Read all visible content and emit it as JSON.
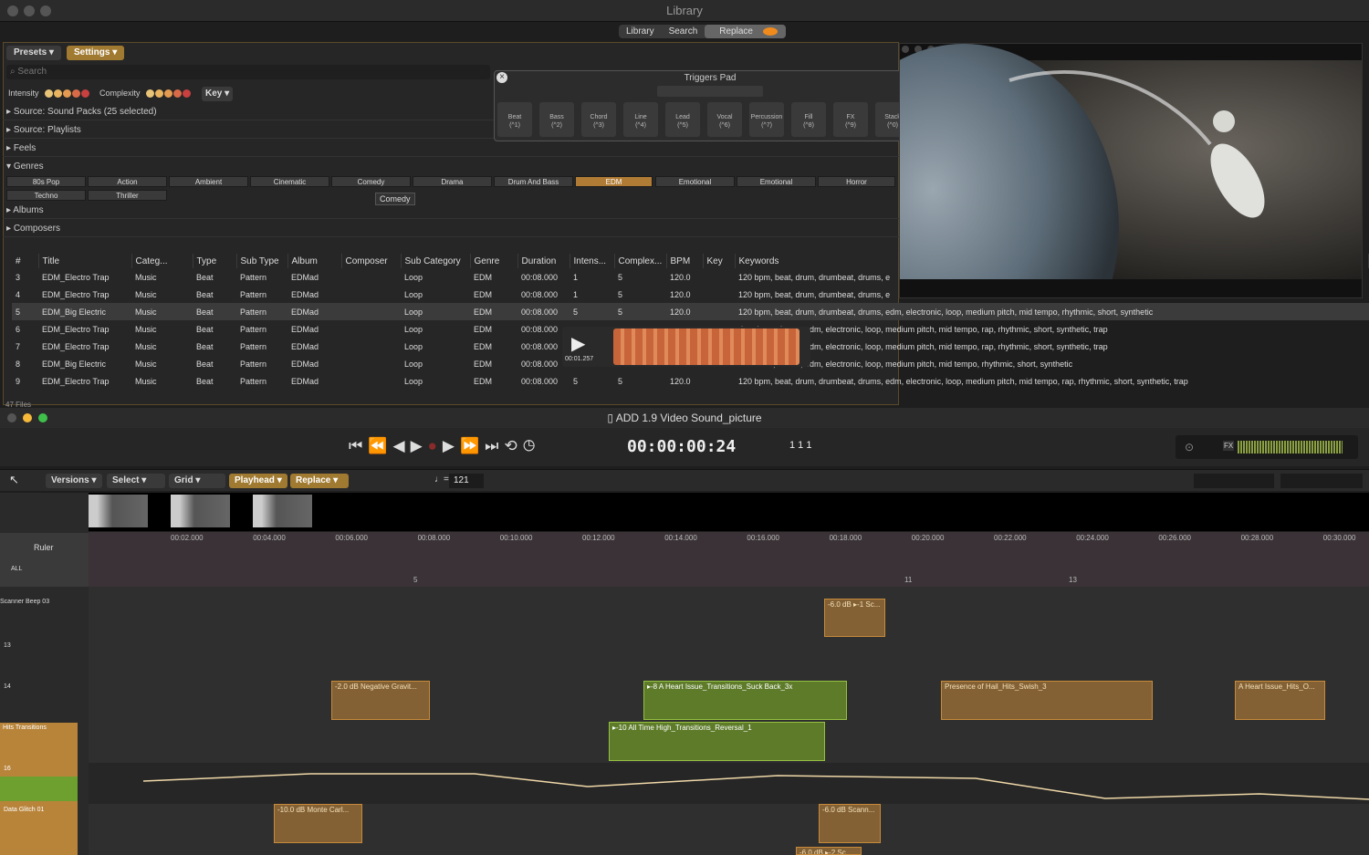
{
  "library": {
    "title": "Library",
    "tabs": [
      "Library",
      "Search",
      "Replace"
    ],
    "presets": "Presets",
    "settings": "Settings",
    "search_placeholder": "Search",
    "intensity": "Intensity",
    "complexity": "Complexity",
    "key": "Key",
    "sections": {
      "sound_packs": "Source: Sound Packs (25 selected)",
      "playlists": "Source: Playlists",
      "feels": "Feels",
      "genres": "Genres",
      "albums": "Albums",
      "composers": "Composers"
    },
    "genres": [
      "80s Pop",
      "Action",
      "Ambient",
      "Cinematic",
      "Comedy",
      "Drama",
      "Drum And Bass",
      "EDM",
      "Emotional",
      "Emotional",
      "Horror",
      "Techno",
      "Thriller"
    ],
    "tooltip": "Comedy",
    "file_count": "47 Files",
    "columns": [
      "#",
      "Title",
      "Categ...",
      "Type",
      "Sub Type",
      "Album",
      "Composer",
      "Sub Category",
      "Genre",
      "Duration",
      "Intens...",
      "Complex...",
      "BPM",
      "Key",
      "Keywords"
    ],
    "rows": [
      [
        "3",
        "EDM_Electro Trap",
        "Music",
        "Beat",
        "Pattern",
        "EDMad",
        "",
        "Loop",
        "EDM",
        "00:08.000",
        "1",
        "5",
        "120.0",
        "",
        "120 bpm, beat, drum, drumbeat, drums, e"
      ],
      [
        "4",
        "EDM_Electro Trap",
        "Music",
        "Beat",
        "Pattern",
        "EDMad",
        "",
        "Loop",
        "EDM",
        "00:08.000",
        "1",
        "5",
        "120.0",
        "",
        "120 bpm, beat, drum, drumbeat, drums, e"
      ],
      [
        "5",
        "EDM_Big Electric",
        "Music",
        "Beat",
        "Pattern",
        "EDMad",
        "",
        "Loop",
        "EDM",
        "00:08.000",
        "5",
        "5",
        "120.0",
        "",
        "120 bpm, beat, drum, drumbeat, drums, edm, electronic, loop, medium pitch, mid tempo, rhythmic, short, synthetic"
      ],
      [
        "6",
        "EDM_Electro Trap",
        "Music",
        "Beat",
        "Pattern",
        "EDMad",
        "",
        "Loop",
        "EDM",
        "00:08.000",
        "",
        "",
        "",
        "",
        "drumbeat, drums, edm, electronic, loop, medium pitch, mid tempo, rap, rhythmic, short, synthetic, trap"
      ],
      [
        "7",
        "EDM_Electro Trap",
        "Music",
        "Beat",
        "Pattern",
        "EDMad",
        "",
        "Loop",
        "EDM",
        "00:08.000",
        "",
        "",
        "",
        "",
        "drumbeat, drums, edm, electronic, loop, medium pitch, mid tempo, rap, rhythmic, short, synthetic, trap"
      ],
      [
        "8",
        "EDM_Big Electric",
        "Music",
        "Beat",
        "Pattern",
        "EDMad",
        "",
        "Loop",
        "EDM",
        "00:08.000",
        "",
        "",
        "",
        "",
        "drumbeat, drums, edm, electronic, loop, medium pitch, mid tempo, rhythmic, short, synthetic"
      ],
      [
        "9",
        "EDM_Electro Trap",
        "Music",
        "Beat",
        "Pattern",
        "EDMad",
        "",
        "Loop",
        "EDM",
        "00:08.000",
        "5",
        "5",
        "120.0",
        "",
        "120 bpm, beat, drum, drumbeat, drums, edm, electronic, loop, medium pitch, mid tempo, rap, rhythmic, short, synthetic, trap"
      ]
    ],
    "preview_time": "00:01.257"
  },
  "triggers": {
    "title": "Triggers Pad",
    "pads": [
      {
        "name": "Beat",
        "key": "(^1)"
      },
      {
        "name": "Bass",
        "key": "(^2)"
      },
      {
        "name": "Chord",
        "key": "(^3)"
      },
      {
        "name": "Line",
        "key": "(^4)"
      },
      {
        "name": "Lead",
        "key": "(^5)"
      },
      {
        "name": "Vocal",
        "key": "(^6)"
      },
      {
        "name": "Percussion",
        "key": "(^7)"
      },
      {
        "name": "Fill",
        "key": "(^8)"
      },
      {
        "name": "FX",
        "key": "(^9)"
      },
      {
        "name": "Stack",
        "key": "(^0)"
      }
    ]
  },
  "project": {
    "title": "ADD 1.9 Video Sound_picture",
    "timecode": "00:00:00:24",
    "bars": "1  1  1",
    "versions": "Versions",
    "select": "Select",
    "grid": "Grid",
    "playhead": "Playhead",
    "replace": "Replace",
    "tempo": "121",
    "ruler": "Ruler",
    "all": "ALL",
    "fx": "FX",
    "ruler_ticks": [
      "00:02.000",
      "00:04.000",
      "00:06.000",
      "00:08.000",
      "00:10.000",
      "00:12.000",
      "00:14.000",
      "00:16.000",
      "00:18.000",
      "00:20.000",
      "00:22.000",
      "00:24.000",
      "00:26.000",
      "00:28.000",
      "00:30.000"
    ],
    "markers": [
      "5",
      "11",
      "13"
    ],
    "tracks": [
      "Scanner Beep 03",
      "Hits Transitions",
      "Data Glitch 01"
    ],
    "track_nums": [
      "13",
      "14",
      "16"
    ],
    "clips": {
      "c1": "-6.0 dB ▸-1 Sc...",
      "c2": "-2.0 dB Negative Gravit...",
      "c3": "▸-8 A Heart Issue_Transitions_Suck Back_3x",
      "c4": "Presence of Hail_Hits_Swish_3",
      "c5": "A Heart Issue_Hits_O...",
      "c6": "▸-10 All Time High_Transitions_Reversal_1",
      "c7": "-10.0 dB Monte Carl...",
      "c8": "-6.0 dB Scann...",
      "c9": "-6.0 dB ▸-2 Sc..."
    }
  }
}
